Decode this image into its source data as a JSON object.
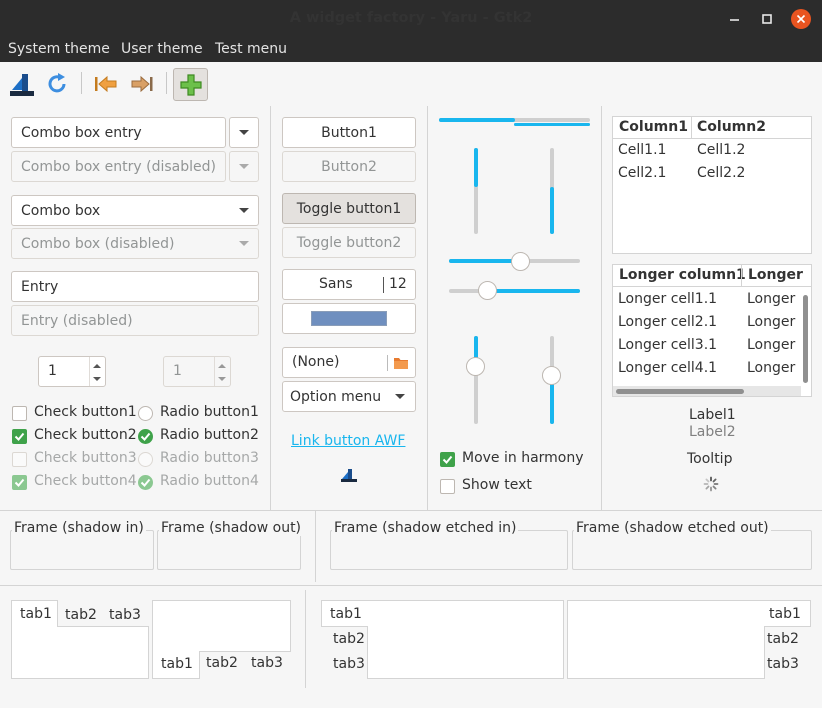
{
  "window": {
    "title": "A widget factory - Yaru - Gtk2"
  },
  "menubar": {
    "items": [
      "System theme",
      "User theme",
      "Test menu"
    ]
  },
  "toolbar": {
    "icons": [
      "app-icon",
      "refresh-icon",
      "go-first-icon",
      "go-last-icon",
      "add-icon"
    ]
  },
  "combos": {
    "entry": "Combo box entry",
    "entry_disabled": "Combo box entry (disabled)",
    "box": "Combo box",
    "box_disabled": "Combo box (disabled)"
  },
  "entries": {
    "entry": "Entry",
    "entry_disabled": "Entry (disabled)"
  },
  "spins": {
    "spin1": "1",
    "spin2": "1"
  },
  "checks": {
    "check1": "Check button1",
    "check2": "Check button2",
    "check3": "Check button3",
    "check4": "Check button4",
    "radio1": "Radio button1",
    "radio2": "Radio button2",
    "radio3": "Radio button3",
    "radio4": "Radio button4"
  },
  "buttons": {
    "button1": "Button1",
    "button2": "Button2",
    "toggle1": "Toggle button1",
    "toggle2": "Toggle button2",
    "font_name": "Sans",
    "font_size": "12",
    "color_value": "#6f8fbf",
    "file_none": "(None)",
    "option_menu": "Option menu",
    "link": "Link button AWF"
  },
  "sliders": {
    "h_top_fill": 0.5,
    "v1_level": 0.45,
    "v2_level": 0.45,
    "h1_level": 0.55,
    "h2_level": 0.3,
    "v3_level": 0.35,
    "v4_level": 0.45
  },
  "harmony": {
    "move": "Move in harmony",
    "show_text": "Show text"
  },
  "tree1": {
    "columns": [
      "Column1",
      "Column2"
    ],
    "rows": [
      [
        "Cell1.1",
        "Cell1.2"
      ],
      [
        "Cell2.1",
        "Cell2.2"
      ]
    ]
  },
  "tree2": {
    "columns": [
      "Longer column1",
      "Longer"
    ],
    "rows": [
      [
        "Longer cell1.1",
        "Longer"
      ],
      [
        "Longer cell2.1",
        "Longer"
      ],
      [
        "Longer cell3.1",
        "Longer"
      ],
      [
        "Longer cell4.1",
        "Longer"
      ]
    ]
  },
  "labels": {
    "label1": "Label1",
    "label2": "Label2",
    "tooltip": "Tooltip"
  },
  "frames": {
    "shadow_in": "Frame (shadow in)",
    "shadow_out": "Frame (shadow out)",
    "etched_in": "Frame (shadow etched in)",
    "etched_out": "Frame (shadow etched out)"
  },
  "tabs": {
    "t1": "tab1",
    "t2": "tab2",
    "t3": "tab3"
  },
  "colors": {
    "accent": "#19b6ee",
    "check": "#3fa24a",
    "link": "#19b6ee"
  }
}
